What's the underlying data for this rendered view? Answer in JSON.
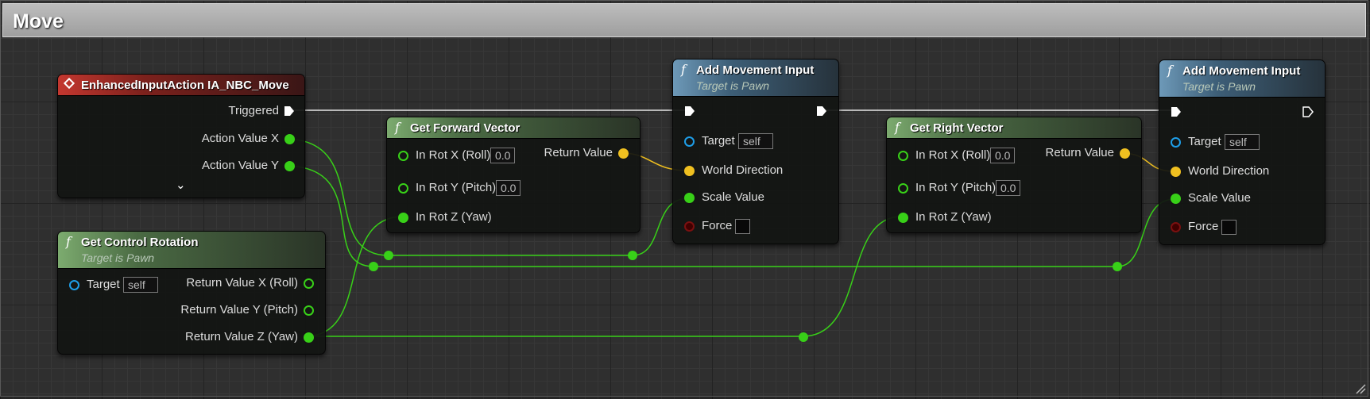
{
  "comment": {
    "title": "Move"
  },
  "nodes": {
    "event": {
      "title": "EnhancedInputAction IA_NBC_Move",
      "pins": {
        "triggered": "Triggered",
        "action_x": "Action Value X",
        "action_y": "Action Value Y"
      },
      "expand_icon": "chevron-down-icon"
    },
    "control_rotation": {
      "title": "Get Control Rotation",
      "subtitle": "Target is Pawn",
      "pins": {
        "target": "Target",
        "target_value": "self",
        "ret_x": "Return Value X (Roll)",
        "ret_y": "Return Value Y (Pitch)",
        "ret_z": "Return Value Z (Yaw)"
      }
    },
    "forward_vector": {
      "title": "Get Forward Vector",
      "pins": {
        "rot_x": "In Rot X (Roll)",
        "rot_x_value": "0.0",
        "rot_y": "In Rot Y (Pitch)",
        "rot_y_value": "0.0",
        "rot_z": "In Rot Z (Yaw)",
        "ret": "Return Value"
      }
    },
    "add_movement_1": {
      "title": "Add Movement Input",
      "subtitle": "Target is Pawn",
      "pins": {
        "target": "Target",
        "target_value": "self",
        "direction": "World Direction",
        "scale": "Scale Value",
        "force": "Force"
      }
    },
    "right_vector": {
      "title": "Get Right Vector",
      "pins": {
        "rot_x": "In Rot X (Roll)",
        "rot_x_value": "0.0",
        "rot_y": "In Rot Y (Pitch)",
        "rot_y_value": "0.0",
        "rot_z": "In Rot Z (Yaw)",
        "ret": "Return Value"
      }
    },
    "add_movement_2": {
      "title": "Add Movement Input",
      "subtitle": "Target is Pawn",
      "pins": {
        "target": "Target",
        "target_value": "self",
        "direction": "World Direction",
        "scale": "Scale Value",
        "force": "Force"
      }
    }
  },
  "colors": {
    "exec_wire": "#e6e6e6",
    "float_wire": "#38d018",
    "vector_wire": "#f0c020",
    "object_pin": "#1e9ee8",
    "bool_pin": "#8a1212"
  },
  "icons": {
    "function": "function-icon",
    "event": "event-diamond-icon"
  }
}
